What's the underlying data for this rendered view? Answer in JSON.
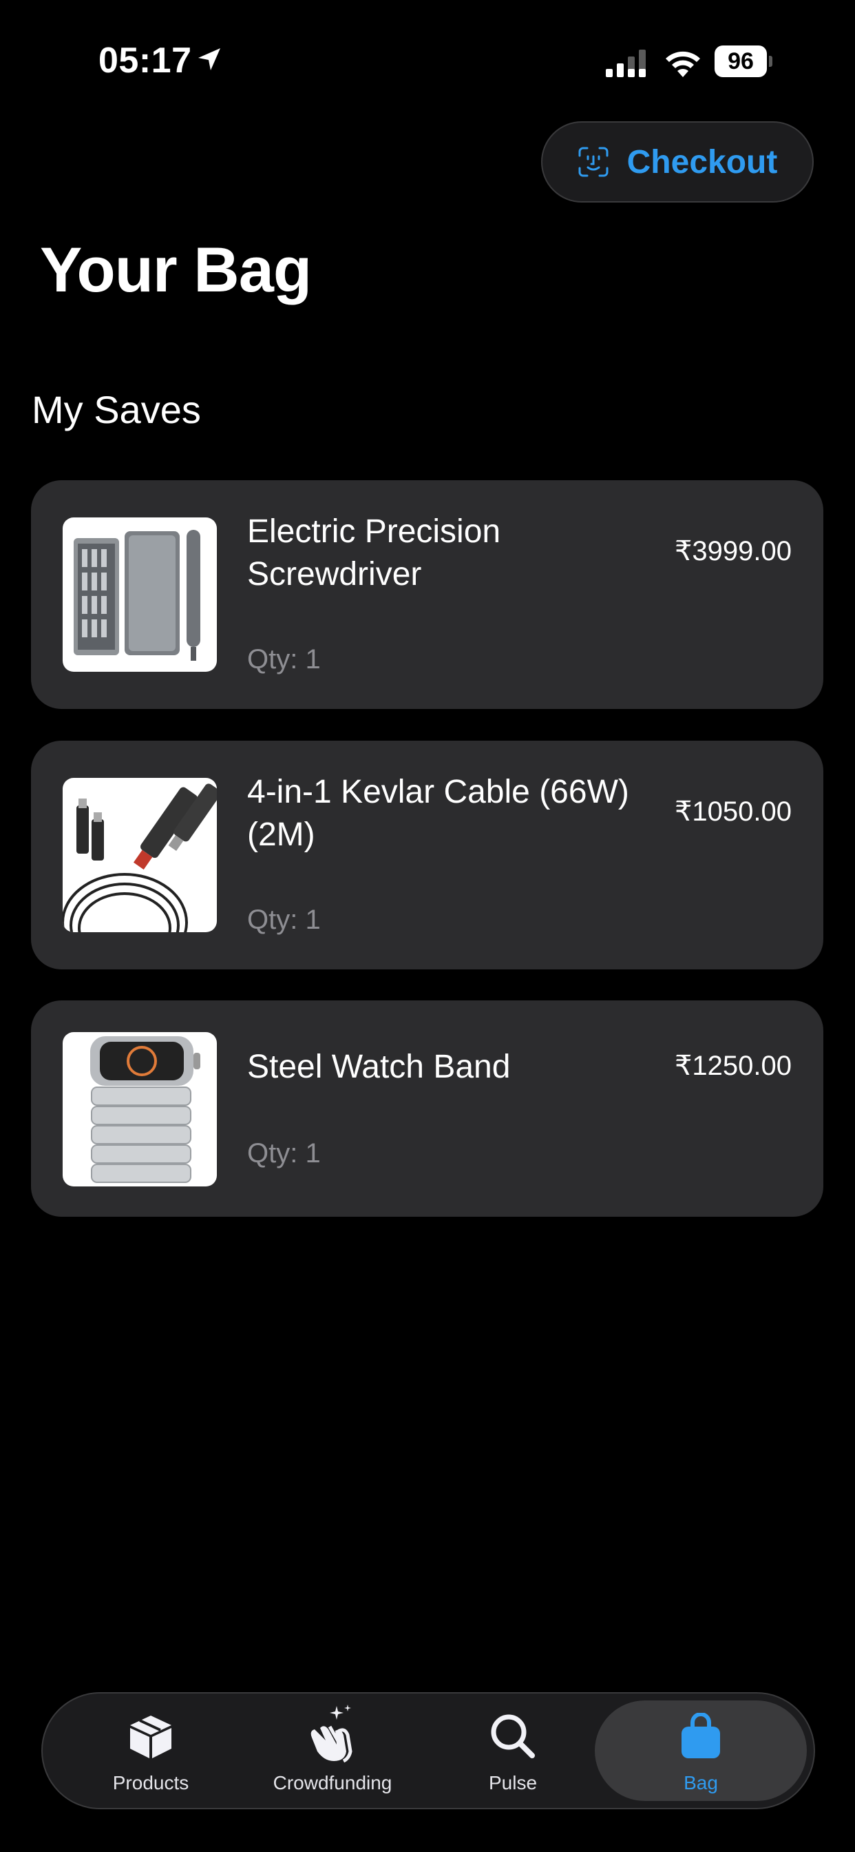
{
  "status_bar": {
    "time": "05:17",
    "battery": "96"
  },
  "header": {
    "checkout_label": "Checkout",
    "title": "Your Bag"
  },
  "saves": {
    "section_title": "My Saves",
    "items": [
      {
        "name": "Electric Precision Screwdriver",
        "price": "₹3999.00",
        "qty": "Qty: 1"
      },
      {
        "name": "4-in-1 Kevlar Cable (66W) (2M)",
        "price": "₹1050.00",
        "qty": "Qty: 1"
      },
      {
        "name": "Steel Watch Band",
        "price": "₹1250.00",
        "qty": "Qty: 1"
      }
    ]
  },
  "tab_bar": {
    "tabs": [
      {
        "label": "Products",
        "icon": "box-icon"
      },
      {
        "label": "Crowdfunding",
        "icon": "clapping-hands-icon"
      },
      {
        "label": "Pulse",
        "icon": "search-icon"
      },
      {
        "label": "Bag",
        "icon": "bag-icon"
      }
    ],
    "active": "Bag"
  },
  "colors": {
    "accent": "#2f9bf0",
    "card_bg": "#2c2c2e",
    "background": "#000000"
  }
}
